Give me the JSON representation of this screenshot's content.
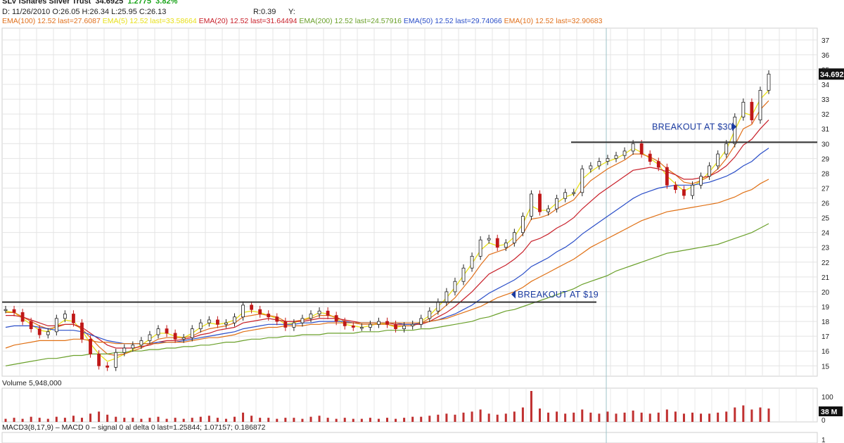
{
  "header": {
    "title": "SLV iShares Silver Trust",
    "last_price": "34.6925",
    "change": "1.2775",
    "change_pct": "3.82%",
    "ohlc": "D: 11/26/2010 O:26.05 H:26.34 L:25.95 C:26.13",
    "r_readout": "R:0.39",
    "y_readout": "Y:",
    "ema_legend": [
      {
        "text": "EMA(100)  12.52 last=27.6087",
        "color": "#e0701c"
      },
      {
        "text": "EMA(5)  12.52 last=33.58664",
        "color": "#e8e01a"
      },
      {
        "text": "EMA(20)  12.52 last=31.64494",
        "color": "#c8202a"
      },
      {
        "text": "EMA(200)  12.52 last=24.57916",
        "color": "#6aa02a"
      },
      {
        "text": "EMA(50)  12.52 last=29.74066",
        "color": "#2a4ec8"
      },
      {
        "text": "EMA(10)  12.52 last=32.90683",
        "color": "#e0701c"
      }
    ]
  },
  "price_label": "34.692",
  "volume_panel": {
    "label": "Volume 5,948,000",
    "scale_top": "100",
    "scale_bottom": "0",
    "last_volume": "38 M"
  },
  "macd_panel": {
    "label": "MACD3(8,17,9) – MACD 0 – signal 0 al delta 0 last=1.25844; 1.07157; 0.186872",
    "scale_top": "1",
    "scale_bottom": "0"
  },
  "annotations": [
    {
      "text": "BREAKOUT AT $19",
      "price": 19.3
    },
    {
      "text": "BREAKOUT AT $30",
      "price": 30.1
    }
  ],
  "chart_data": {
    "type": "line",
    "y_ticks": [
      15,
      16,
      17,
      18,
      19,
      20,
      21,
      22,
      23,
      24,
      25,
      26,
      27,
      28,
      29,
      30,
      31,
      32,
      33,
      34,
      35,
      36,
      37
    ],
    "ylim": [
      14.3,
      37.8
    ],
    "grid": true,
    "horizontal_lines": [
      19.3,
      30.1
    ],
    "series": [
      {
        "name": "Close",
        "color": "#111111",
        "values": [
          18.8,
          18.6,
          18.0,
          17.5,
          17.1,
          17.3,
          18.2,
          18.5,
          17.9,
          16.8,
          15.8,
          15.0,
          14.9,
          15.9,
          16.2,
          16.4,
          16.7,
          17.1,
          17.5,
          17.2,
          16.8,
          16.9,
          17.5,
          17.9,
          18.1,
          17.8,
          17.9,
          18.3,
          19.1,
          18.8,
          18.5,
          18.3,
          18.0,
          17.6,
          17.9,
          18.2,
          18.5,
          18.7,
          18.4,
          18.0,
          17.7,
          17.6,
          17.6,
          17.8,
          18.0,
          17.8,
          17.5,
          17.7,
          17.8,
          18.2,
          18.7,
          19.3,
          20.0,
          20.7,
          21.6,
          22.4,
          23.5,
          23.6,
          23.0,
          23.3,
          24.0,
          25.1,
          26.6,
          25.4,
          25.6,
          26.3,
          26.7,
          26.7,
          28.3,
          28.5,
          28.8,
          29.0,
          29.2,
          29.5,
          30.0,
          29.3,
          28.8,
          28.4,
          27.2,
          26.9,
          26.5,
          27.2,
          27.8,
          28.5,
          29.3,
          30.0,
          31.8,
          32.8,
          31.6,
          33.6,
          34.7
        ]
      },
      {
        "name": "EMA(5)",
        "color": "#e8e01a",
        "values": [
          18.7,
          18.6,
          18.2,
          17.8,
          17.4,
          17.3,
          17.7,
          18.1,
          18.0,
          17.4,
          16.5,
          15.8,
          15.3,
          15.5,
          15.8,
          16.1,
          16.4,
          16.8,
          17.2,
          17.2,
          17.0,
          16.9,
          17.2,
          17.6,
          17.9,
          17.8,
          17.9,
          18.1,
          18.6,
          18.7,
          18.6,
          18.4,
          18.2,
          17.8,
          17.9,
          18.1,
          18.3,
          18.6,
          18.5,
          18.2,
          17.8,
          17.7,
          17.6,
          17.7,
          17.9,
          17.8,
          17.6,
          17.7,
          17.7,
          18.0,
          18.4,
          19.0,
          19.6,
          20.3,
          21.1,
          21.9,
          22.8,
          23.3,
          23.1,
          23.2,
          23.7,
          24.6,
          25.8,
          25.5,
          25.5,
          26.0,
          26.4,
          26.6,
          27.6,
          28.1,
          28.5,
          28.8,
          29.0,
          29.3,
          29.7,
          29.4,
          29.0,
          28.6,
          27.8,
          27.3,
          26.8,
          27.1,
          27.5,
          28.1,
          28.8,
          29.6,
          30.9,
          32.1,
          31.9,
          33.0,
          33.6
        ]
      },
      {
        "name": "EMA(10)",
        "color": "#e0701c",
        "values": [
          18.6,
          18.6,
          18.3,
          18.0,
          17.7,
          17.5,
          17.6,
          17.8,
          17.8,
          17.5,
          16.9,
          16.3,
          15.8,
          15.7,
          15.8,
          16.0,
          16.2,
          16.5,
          16.8,
          16.9,
          16.9,
          16.9,
          17.0,
          17.3,
          17.5,
          17.6,
          17.7,
          17.9,
          18.3,
          18.4,
          18.5,
          18.4,
          18.3,
          18.0,
          18.0,
          18.1,
          18.2,
          18.4,
          18.4,
          18.3,
          18.0,
          17.9,
          17.8,
          17.8,
          17.8,
          17.8,
          17.7,
          17.7,
          17.7,
          17.9,
          18.2,
          18.6,
          19.1,
          19.6,
          20.3,
          21.0,
          21.8,
          22.5,
          22.7,
          22.9,
          23.3,
          23.9,
          24.9,
          25.0,
          25.2,
          25.6,
          25.9,
          26.2,
          26.9,
          27.5,
          27.9,
          28.3,
          28.6,
          28.9,
          29.3,
          29.3,
          29.1,
          28.8,
          28.3,
          27.9,
          27.4,
          27.3,
          27.5,
          27.8,
          28.3,
          29.0,
          29.9,
          31.0,
          31.3,
          32.3,
          32.9
        ]
      },
      {
        "name": "EMA(20)",
        "color": "#c8202a",
        "values": [
          18.4,
          18.4,
          18.3,
          18.1,
          17.9,
          17.7,
          17.7,
          17.8,
          17.8,
          17.6,
          17.2,
          16.8,
          16.4,
          16.2,
          16.2,
          16.2,
          16.3,
          16.4,
          16.6,
          16.7,
          16.7,
          16.8,
          16.9,
          17.1,
          17.2,
          17.4,
          17.5,
          17.6,
          17.9,
          18.0,
          18.1,
          18.2,
          18.1,
          18.0,
          18.0,
          18.0,
          18.1,
          18.2,
          18.2,
          18.2,
          18.1,
          18.0,
          17.9,
          17.9,
          17.9,
          17.9,
          17.8,
          17.8,
          17.8,
          17.8,
          18.0,
          18.3,
          18.6,
          19.0,
          19.5,
          20.0,
          20.6,
          21.2,
          21.5,
          21.8,
          22.2,
          22.7,
          23.4,
          23.6,
          23.9,
          24.3,
          24.6,
          25.0,
          25.6,
          26.1,
          26.6,
          27.0,
          27.4,
          27.8,
          28.2,
          28.3,
          28.4,
          28.3,
          28.1,
          27.9,
          27.6,
          27.6,
          27.7,
          27.8,
          28.1,
          28.5,
          29.1,
          29.9,
          30.3,
          31.0,
          31.6
        ]
      },
      {
        "name": "EMA(50)",
        "color": "#2a4ec8",
        "values": [
          17.6,
          17.7,
          17.7,
          17.7,
          17.6,
          17.5,
          17.4,
          17.4,
          17.4,
          17.3,
          17.1,
          16.9,
          16.7,
          16.6,
          16.5,
          16.5,
          16.5,
          16.5,
          16.6,
          16.6,
          16.6,
          16.7,
          16.8,
          16.9,
          17.0,
          17.1,
          17.2,
          17.3,
          17.5,
          17.6,
          17.7,
          17.8,
          17.8,
          17.8,
          17.8,
          17.9,
          17.9,
          18.0,
          18.0,
          18.0,
          18.0,
          17.9,
          17.9,
          17.9,
          17.9,
          17.9,
          17.9,
          17.8,
          17.8,
          17.9,
          18.0,
          18.1,
          18.3,
          18.5,
          18.8,
          19.1,
          19.5,
          19.9,
          20.2,
          20.5,
          20.8,
          21.2,
          21.7,
          22.0,
          22.3,
          22.7,
          23.0,
          23.4,
          23.9,
          24.3,
          24.7,
          25.1,
          25.5,
          25.9,
          26.3,
          26.6,
          26.8,
          27.0,
          27.1,
          27.2,
          27.2,
          27.2,
          27.3,
          27.4,
          27.6,
          27.8,
          28.1,
          28.5,
          28.8,
          29.3,
          29.7
        ]
      },
      {
        "name": "EMA(100)",
        "color": "#e07014",
        "values": [
          16.2,
          16.4,
          16.5,
          16.6,
          16.7,
          16.7,
          16.7,
          16.7,
          16.8,
          16.8,
          16.7,
          16.6,
          16.6,
          16.5,
          16.5,
          16.5,
          16.5,
          16.5,
          16.5,
          16.6,
          16.6,
          16.6,
          16.7,
          16.8,
          16.9,
          16.9,
          17.0,
          17.1,
          17.3,
          17.4,
          17.5,
          17.6,
          17.6,
          17.7,
          17.7,
          17.7,
          17.8,
          17.8,
          17.9,
          17.9,
          17.9,
          17.9,
          17.9,
          17.9,
          17.9,
          17.9,
          17.9,
          17.9,
          17.9,
          17.9,
          18.0,
          18.1,
          18.2,
          18.4,
          18.6,
          18.8,
          19.0,
          19.3,
          19.6,
          19.8,
          20.0,
          20.3,
          20.7,
          21.0,
          21.3,
          21.6,
          21.9,
          22.2,
          22.6,
          23.0,
          23.3,
          23.6,
          23.9,
          24.2,
          24.5,
          24.8,
          25.0,
          25.2,
          25.4,
          25.5,
          25.6,
          25.7,
          25.8,
          25.9,
          26.0,
          26.2,
          26.4,
          26.7,
          26.9,
          27.3,
          27.6
        ]
      },
      {
        "name": "EMA(200)",
        "color": "#6aa02a",
        "values": [
          15.0,
          15.1,
          15.2,
          15.3,
          15.4,
          15.5,
          15.5,
          15.6,
          15.7,
          15.7,
          15.8,
          15.8,
          15.8,
          15.9,
          15.9,
          16.0,
          16.0,
          16.1,
          16.1,
          16.2,
          16.2,
          16.3,
          16.3,
          16.4,
          16.4,
          16.5,
          16.6,
          16.6,
          16.7,
          16.8,
          16.8,
          16.9,
          16.9,
          17.0,
          17.0,
          17.1,
          17.1,
          17.1,
          17.2,
          17.2,
          17.2,
          17.2,
          17.3,
          17.3,
          17.3,
          17.4,
          17.4,
          17.4,
          17.4,
          17.5,
          17.5,
          17.6,
          17.7,
          17.8,
          17.9,
          18.0,
          18.2,
          18.3,
          18.5,
          18.7,
          18.8,
          19.0,
          19.2,
          19.4,
          19.6,
          19.8,
          20.0,
          20.2,
          20.5,
          20.7,
          20.9,
          21.1,
          21.4,
          21.6,
          21.8,
          22.0,
          22.2,
          22.4,
          22.6,
          22.7,
          22.8,
          22.9,
          23.0,
          23.1,
          23.2,
          23.4,
          23.6,
          23.8,
          24.0,
          24.3,
          24.6
        ]
      }
    ],
    "volume": [
      3,
      4,
      3,
      5,
      4,
      3,
      5,
      4,
      6,
      4,
      8,
      10,
      7,
      5,
      4,
      4,
      3,
      4,
      5,
      3,
      4,
      3,
      4,
      5,
      6,
      4,
      3,
      5,
      9,
      6,
      4,
      4,
      3,
      4,
      4,
      3,
      5,
      6,
      4,
      3,
      4,
      3,
      3,
      4,
      3,
      4,
      3,
      4,
      5,
      5,
      6,
      7,
      8,
      7,
      9,
      10,
      12,
      8,
      7,
      8,
      10,
      14,
      30,
      13,
      9,
      10,
      8,
      9,
      12,
      9,
      8,
      10,
      8,
      9,
      11,
      9,
      8,
      9,
      12,
      10,
      8,
      9,
      8,
      8,
      9,
      10,
      14,
      16,
      12,
      14,
      13
    ]
  }
}
